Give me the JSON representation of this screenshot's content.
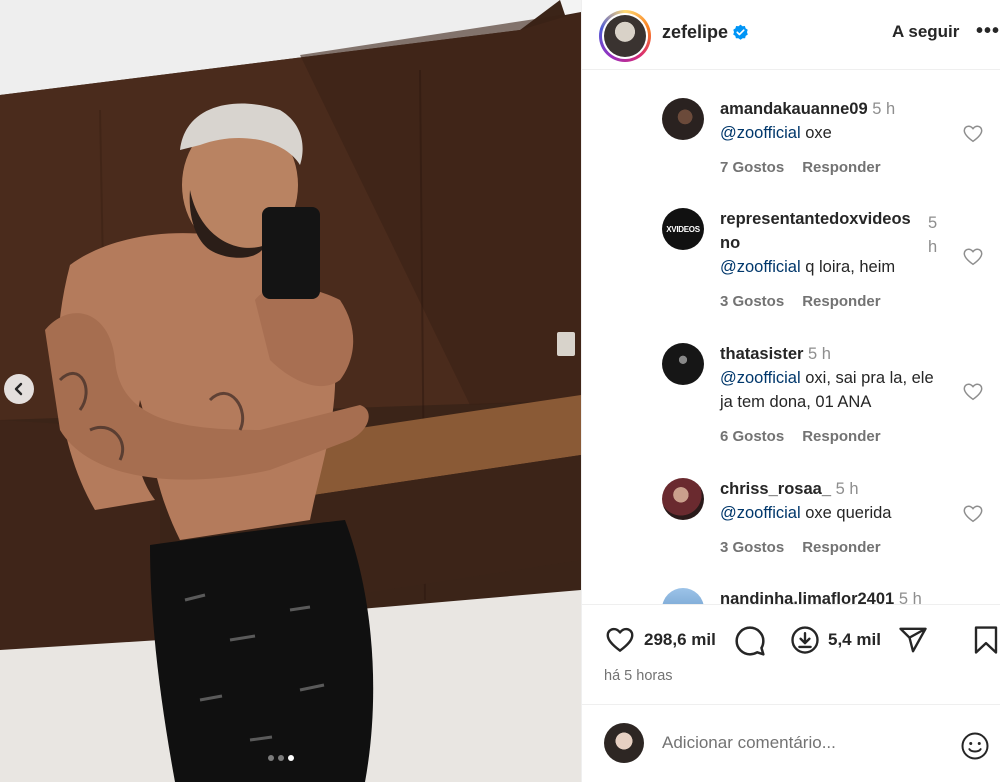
{
  "post": {
    "author": "zefelipe",
    "follow_label": "A seguir",
    "more_label": "•••",
    "likes": "298,6 mil",
    "saves": "5,4 mil",
    "time_ago": "há 5 horas",
    "carousel": {
      "total": 3,
      "active_index": 3
    }
  },
  "comments": [
    {
      "user": "amandakauanne09",
      "time": "5 h",
      "mention": "@zoofficial",
      "text": "oxe",
      "likes": "7 Gostos",
      "reply": "Responder",
      "avatar_color": "#2a2220"
    },
    {
      "user": "representantedoxvideos",
      "user_suffix": "no",
      "time": "5 h",
      "mention": "@zoofficial",
      "text": "q loira, heim",
      "likes": "3 Gostos",
      "reply": "Responder",
      "avatar_color": "#111111",
      "avatar_text": "XVIDEOS"
    },
    {
      "user": "thatasister",
      "time": "5 h",
      "mention": "@zoofficial",
      "text": "oxi, sai pra la, ele ja tem dona, 01 ANA",
      "likes": "6 Gostos",
      "reply": "Responder",
      "avatar_color": "#161616"
    },
    {
      "user": "chriss_rosaa_",
      "time": "5 h",
      "mention": "@zoofficial",
      "text": "oxe querida",
      "likes": "3 Gostos",
      "reply": "Responder",
      "avatar_color": "#6a2a2f"
    },
    {
      "user": "nandinha.limaflor2401",
      "time": "5 h",
      "avatar_color": "#7aa7d6"
    }
  ],
  "add_comment": {
    "placeholder": "Adicionar comentário..."
  },
  "colors": {
    "link": "#00376b",
    "muted": "#737373",
    "verified": "#0095f6"
  }
}
